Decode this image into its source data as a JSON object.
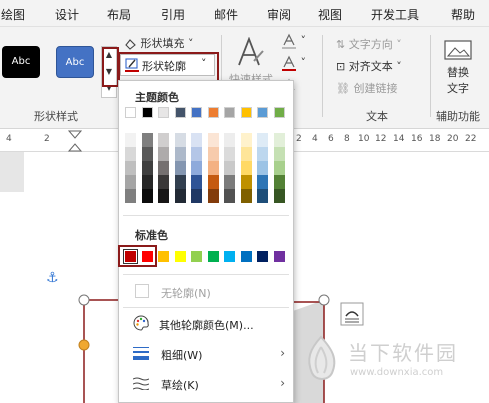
{
  "menubar": {
    "tabs": [
      "绘图",
      "设计",
      "布局",
      "引用",
      "邮件",
      "审阅",
      "视图",
      "开发工具",
      "帮助"
    ]
  },
  "ribbon": {
    "style_samples": [
      "Abc",
      "Abc"
    ],
    "shape_fill": "形状填充",
    "shape_outline": "形状轮廓",
    "quick_styles": "快速样式",
    "text_direction": "文字方向",
    "align_text": "对齐文本",
    "create_link": "创建链接",
    "alt_text": [
      "替换",
      "文字"
    ],
    "groups": [
      "形状样式",
      "文本",
      "辅助功能"
    ]
  },
  "ruler": {
    "left_nums": [
      "4",
      "2"
    ],
    "right_nums": [
      "2",
      "4",
      "6",
      "8",
      "10",
      "12",
      "14",
      "16",
      "18",
      "20",
      "22"
    ]
  },
  "dropdown": {
    "theme_colors_label": "主题颜色",
    "standard_colors_label": "标准色",
    "no_outline": "无轮廓(N)",
    "more_colors": "其他轮廓颜色(M)...",
    "weight": "粗细(W)",
    "sketch": "草绘(K)",
    "theme_top_row": [
      "#ffffff",
      "#000000",
      "#e7e6e6",
      "#44546a",
      "#4472c4",
      "#ed7d31",
      "#a5a5a5",
      "#ffc000",
      "#5b9bd5",
      "#70ad47"
    ],
    "theme_shades": [
      [
        "#f2f2f2",
        "#7f7f7f",
        "#d0cece",
        "#d6dce4",
        "#d9e2f3",
        "#fbe5d5",
        "#ededed",
        "#fff2cc",
        "#deebf6",
        "#e2efd9"
      ],
      [
        "#d8d8d8",
        "#595959",
        "#aeabab",
        "#adb9ca",
        "#b4c6e7",
        "#f7cbac",
        "#dbdbdb",
        "#fee599",
        "#bdd7ee",
        "#c5e0b3"
      ],
      [
        "#bfbfbf",
        "#3f3f3f",
        "#757070",
        "#8496b0",
        "#8eaadb",
        "#f4b183",
        "#c9c9c9",
        "#ffd965",
        "#9cc3e5",
        "#a8d08d"
      ],
      [
        "#a5a5a5",
        "#262626",
        "#3a3838",
        "#323f4f",
        "#2f5496",
        "#c55a11",
        "#7b7b7b",
        "#bf9000",
        "#2e75b5",
        "#538135"
      ],
      [
        "#7f7f7f",
        "#0c0c0c",
        "#171616",
        "#222a35",
        "#1f3864",
        "#833c0b",
        "#525252",
        "#7f6000",
        "#1e4e79",
        "#375623"
      ]
    ],
    "standard_row": [
      "#c00000",
      "#ff0000",
      "#ffc000",
      "#ffff00",
      "#92d050",
      "#00b050",
      "#00b0f0",
      "#0070c0",
      "#002060",
      "#7030a0"
    ]
  },
  "watermark": {
    "title": "当下软件园",
    "url": "www.downxia.com"
  }
}
